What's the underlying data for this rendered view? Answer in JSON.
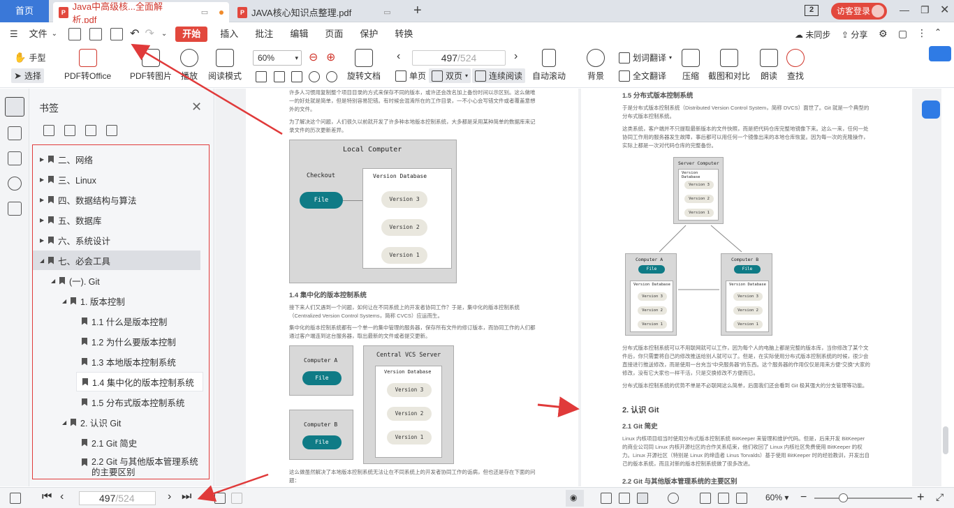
{
  "tabs": {
    "home": "首页",
    "doc1": "Java中高级核...全面解析.pdf",
    "doc2": "JAVA核心知识点整理.pdf",
    "badge": "2",
    "login": "访客登录"
  },
  "menu": {
    "file": "文件",
    "start": "开始",
    "insert": "插入",
    "annotate": "批注",
    "edit": "编辑",
    "page": "页面",
    "protect": "保护",
    "convert": "转换",
    "sync": "未同步",
    "share": "分享"
  },
  "toolbar": {
    "hand": "手型",
    "select": "选择",
    "pdf_office": "PDF转Office",
    "pdf_image": "PDF转图片",
    "play": "播放",
    "read_mode": "阅读模式",
    "zoom": "60%",
    "page_current": "497",
    "page_total": "/524",
    "rotate": "旋转文档",
    "single": "单页",
    "double": "双页",
    "continuous": "连续阅读",
    "auto_scroll": "自动滚动",
    "background": "背景",
    "word_translate": "划词翻译",
    "full_translate": "全文翻译",
    "compress": "压缩",
    "screenshot_compare": "截图和对比",
    "read_aloud": "朗读",
    "find": "查找"
  },
  "sidebar": {
    "title": "书签",
    "items": [
      {
        "label": "二、网络"
      },
      {
        "label": "三、Linux"
      },
      {
        "label": "四、数据结构与算法"
      },
      {
        "label": "五、数据库"
      },
      {
        "label": "六、系统设计"
      },
      {
        "label": "七、必会工具"
      },
      {
        "label": "(一). Git"
      },
      {
        "label": "1. 版本控制"
      },
      {
        "label": "1.1 什么是版本控制"
      },
      {
        "label": "1.2 为什么要版本控制"
      },
      {
        "label": "1.3 本地版本控制系统"
      },
      {
        "label": "1.4 集中化的版本控制系统"
      },
      {
        "label": "1.5 分布式版本控制系统"
      },
      {
        "label": "2. 认识 Git"
      },
      {
        "label": "2.1 Git 简史"
      },
      {
        "label": "2.2 Git 与其他版本管理系统的主要区别"
      }
    ]
  },
  "pageL": {
    "p1": "许多人习惯用复制整个项目目录的方式来保存不同的版本，或许还会改名加上备份时间以示区别。这么做唯一的好处就是简单，但是特别容易犯错。有时候会混淆所在的工作目录，一不小心会写错文件或者覆盖意想外的文件。",
    "p2": "为了解决这个问题，人们很久以前就开发了许多种本地版本控制系统，大多都是采用某种简单的数据库来记录文件的历次更新差异。",
    "diag1_title": "Local Computer",
    "diag1_checkout": "Checkout",
    "diag1_db": "Version Database",
    "file": "File",
    "v3": "Version 3",
    "v2": "Version 2",
    "v1": "Version 1",
    "h14": "1.4 集中化的版本控制系统",
    "p3": "接下来人们又遇到一个问题，如何让在不同系统上的开发者协同工作？于是，集中化的版本控制系统（Centralized Version Control Systems，简称 CVCS）应运而生。",
    "p4": "集中化的版本控制系统都有一个单一的集中管理的服务器，保存所有文件的修订版本，而协同工作的人们都通过客户端连到这台服务器，取出最新的文件或者提交更新。",
    "compA": "Computer A",
    "compB": "Computer B",
    "server": "Central VCS Server",
    "p5": "这么做虽然解决了本地版本控制系统无法让在不同系统上的开发者协同工作的诟病，但也还是存在下面的问题："
  },
  "pageR": {
    "h15": "1.5 分布式版本控制系统",
    "p1": "于是分布式版本控制系统（Distributed Version Control System，简称 DVCS）面世了。Git 就是一个典型的分布式版本控制系统。",
    "p2": "这类系统，客户端并不只提取最新版本的文件快照，而是把代码仓库完整地镜像下来。这么一来，任何一处协同工作用的服务器发生故障，事后都可以用任何一个镜像出来的本地仓库恢复。因为每一次的克隆操作，实际上都是一次对代码仓库的完整备份。",
    "server": "Server Computer",
    "db": "Version Database",
    "compA": "Computer A",
    "compB": "Computer B",
    "file": "File",
    "v3": "Version 3",
    "v2": "Version 2",
    "v1": "Version 1",
    "p3": "分布式版本控制系统可以不用联网就可以工作，因为每个人的电脑上都是完整的版本库，当你修改了某个文件后，你只需要将自己的修改推送给别人就可以了。但是，在实际使用分布式版本控制系统的时候，很少会直接进行推送修改，而是使用一台充当“中央服务器”的东西。这个服务器的作用仅仅是用来方便“交换”大家的修改，没有它大家也一样干活，只是交换修改不方便而已。",
    "p4": "分布式版本控制系统的优势不单是不必联网这么简单，后面我们还会看到 Git 极其强大的分支管理等功能。",
    "h2": "2. 认识 Git",
    "h21": "2.1 Git 简史",
    "p5": "Linux 内核项目组当时使用分布式版本控制系统 BitKeeper 来管理和维护代码。但是，后来开发 BitKeeper 的商业公司同 Linux 内核开源社区的合作关系结束，他们收回了 Linux 内核社区免费使用 BitKeeper 的权力。Linux 开源社区（特别是 Linux 的缔造者 Linus Torvalds）基于使用 BitKeeper 时的经验教训，开发出自己的版本系统，而且对新的版本控制系统做了很多改进。",
    "h22": "2.2 Git 与其他版本管理系统的主要区别"
  },
  "status": {
    "page_current": "497",
    "page_total": "/524",
    "zoom": "60%"
  }
}
